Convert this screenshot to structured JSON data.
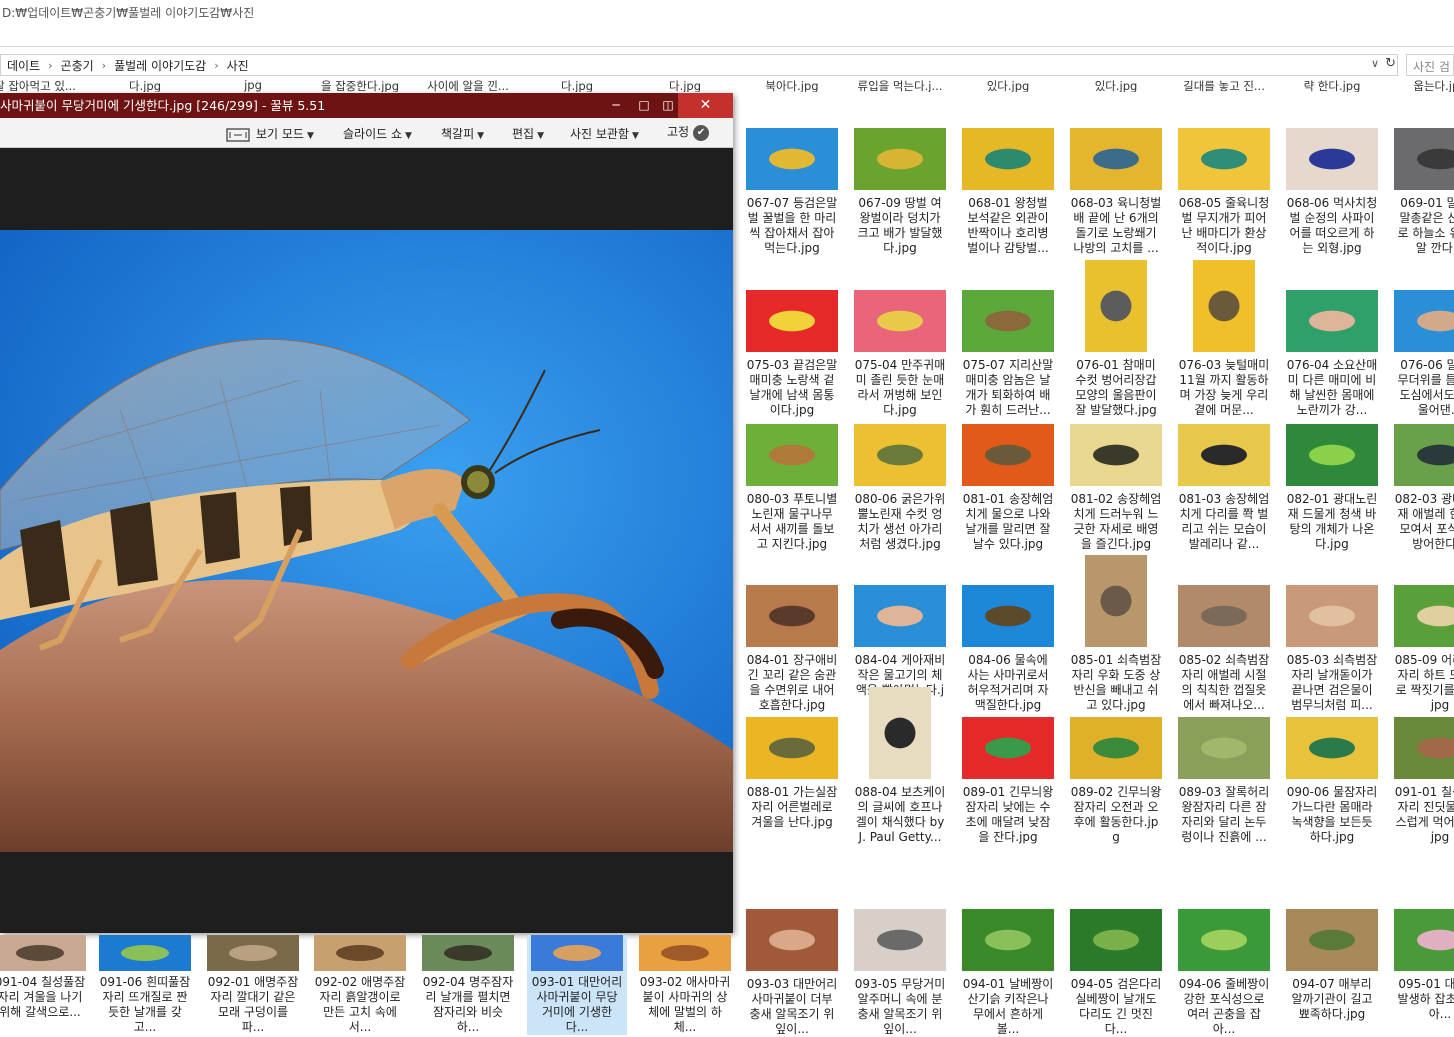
{
  "window": {
    "path_title": "D:₩업데이트₩곤충기₩풀벌레 이야기도감₩사진"
  },
  "address": {
    "crumbs": [
      "데이트",
      "곤충기",
      "풀벌레 이야기도감",
      "사진"
    ],
    "dropdown": "∨",
    "refresh": "↻",
    "search_placeholder": "사진 검"
  },
  "top_partial_captions": [
    "잘 잡아먹고 있...",
    "다.jpg",
    "jpg",
    "을 잡중한다.jpg",
    "사이에 알을 낀...",
    "다.jpg",
    "다.jpg",
    "북아다.jpg",
    "류입을 먹는다.j...",
    "있다.jpg",
    "있다.jpg",
    "길대를 놓고 진...",
    "략 한다.jpg",
    "웁는다.jpg"
  ],
  "grid": [
    {
      "caption": "067-07 등검은말벌 꿀벌을 한 마리씩 잡아채서 잡아먹는다.jpg",
      "colors": [
        "#2a8fd6",
        "#e2b832"
      ]
    },
    {
      "caption": "067-09 땅벌 여왕벌이라 덩치가 크고 배가 발달했다.jpg",
      "colors": [
        "#6aa42e",
        "#d8b433"
      ]
    },
    {
      "caption": "068-01 왕청벌 보석같은 외관이 반짝이나 호리병벌이나 감탕벌...",
      "colors": [
        "#e7b825",
        "#2e8a6c"
      ]
    },
    {
      "caption": "068-03 육니청벌 배 끝에 난 6개의 돌기로 노랑쐐기나방의 고치를 ...",
      "colors": [
        "#e5b52d",
        "#3d6b8a"
      ]
    },
    {
      "caption": "068-05 줄육니청벌 무지개가 피어난 배마디가 환상적이다.jpg",
      "colors": [
        "#f0c53a",
        "#2f8d78"
      ]
    },
    {
      "caption": "068-06 먹사치청벌 순정의 사파이어를 떠오르게 하는 외형.jpg",
      "colors": [
        "#e6d8cc",
        "#2a3a96"
      ]
    },
    {
      "caption": "069-01 말발을 말총같은 산란으로 하늘소 유충에 알 깐다...",
      "colors": [
        "#6b6a6c",
        "#3a3a3a"
      ]
    },
    {
      "caption": "075-03 끝검은말매미충 노랑색 겉날개에 남색 몸통이다.jpg",
      "colors": [
        "#e62a2a",
        "#f0d23a"
      ]
    },
    {
      "caption": "075-04 만주귀매미 졸린 듯한 눈매라서 꺼벙해 보인다.jpg",
      "colors": [
        "#e8657a",
        "#e9c94a"
      ]
    },
    {
      "caption": "075-07 지리산말매미충 암놈은 날개가 퇴화하여 배가 훤히 드러난...",
      "colors": [
        "#5da83a",
        "#8a6a3a"
      ]
    },
    {
      "caption": "076-01 참매미 수컷 벙어리장갑 모양의 울음판이 잘 발달했다.jpg",
      "colors": [
        "#e9c02e",
        "#5c5c5c"
      ]
    },
    {
      "caption": "076-03 늦털매미 11월 까지 활동하며 가장 늦게 우리곁에 머문...",
      "colors": [
        "#f0c02a",
        "#6a5a3a"
      ]
    },
    {
      "caption": "076-04 소요산매미 다른 매미에 비해 날씬한 몸매에 노란끼가 강...",
      "colors": [
        "#2fa06a",
        "#e0b49a"
      ]
    },
    {
      "caption": "076-06 말매미 무더위를 틈타 여 도심에서도 에도 울어댄...",
      "colors": [
        "#2a8fd6",
        "#d2a98a"
      ]
    },
    {
      "caption": "080-03 푸토니별노린재 물구나무서서 새끼를 돌보고 지킨다.jpg",
      "colors": [
        "#6cb03a",
        "#b07a3a"
      ]
    },
    {
      "caption": "080-06 굵은가위뿔노린재 수컷 엉치가 생선 아가리처럼 생겼다.jpg",
      "colors": [
        "#ecc030",
        "#6a7a3a"
      ]
    },
    {
      "caption": "081-01 송장헤엄치게 물으로 나와 날개를 말리면 잘 날수 있다.jpg",
      "colors": [
        "#e25a1a",
        "#6a5a3a"
      ]
    },
    {
      "caption": "081-02 송장헤엄치게 드러누워 느긋한 자세로 배영을 즐긴다.jpg",
      "colors": [
        "#e8d890",
        "#3a3a2a"
      ]
    },
    {
      "caption": "081-03 송장헤엄치게 다리를 쫙 벌리고 쉬는 모습이 발레리나 같...",
      "colors": [
        "#e8c84a",
        "#2a2a2a"
      ]
    },
    {
      "caption": "082-01 광대노린재 드물게 청색 바탕의 개체가 나온다.jpg",
      "colors": [
        "#2e8a3a",
        "#8ad04a"
      ]
    },
    {
      "caption": "082-03 광대노린재 애벌레 한데로 모여서 포식자를 방어한다...",
      "colors": [
        "#6aa04a",
        "#2a3a3a"
      ]
    },
    {
      "caption": "084-01 장구애비 긴 꼬리 같은 숨관을 수면위로 내어 호흡한다.jpg",
      "colors": [
        "#b87a4a",
        "#5a3a2a"
      ]
    },
    {
      "caption": "084-04 게아재비 작은 물고기의 체액을 빨아먹는다.jpg",
      "colors": [
        "#2a8fd6",
        "#e0b498"
      ]
    },
    {
      "caption": "084-06 물속에 사는 사마귀로서 허우적거리며 자맥질한다.jpg",
      "colors": [
        "#1e88d8",
        "#5a4a2a"
      ]
    },
    {
      "caption": "085-01 쇠측범잠자리 우화 도중 상반신을 빼내고 쉬고 있다.jpg",
      "colors": [
        "#b8986a",
        "#6a5a4a"
      ]
    },
    {
      "caption": "085-02 쇠측범잠자리 애벌레 시절의 칙칙한 껍질옷에서 빠져나오...",
      "colors": [
        "#b08a6a",
        "#7a6a5a"
      ]
    },
    {
      "caption": "085-03 쇠측범잠자리 날개돋이가 끝나면 검은물이 범무늬처럼 피...",
      "colors": [
        "#c89a7a",
        "#e0c0a0"
      ]
    },
    {
      "caption": "085-09 어리장잠자리 하트 모양으로 짝짓기를 한다.jpg",
      "colors": [
        "#5aa03a",
        "#e0d0a0"
      ]
    },
    {
      "caption": "088-01 가는실잠자리 어른벌레로 겨울을 난다.jpg",
      "colors": [
        "#eab624",
        "#6a6a3a"
      ]
    },
    {
      "caption": "088-04 보츠케이의 글씨에 호프나겔이 채식했다 by J. Paul Getty...",
      "colors": [
        "#e8dcc0",
        "#2a2a2a"
      ]
    },
    {
      "caption": "089-01 긴무늬왕잠자리 낮에는 수초에 매달려 낮잠을 잔다.jpg",
      "colors": [
        "#e42a2a",
        "#3a9a4a"
      ]
    },
    {
      "caption": "089-02 긴무늬왕잠자리 오전과 오후에 활동한다.jpg",
      "colors": [
        "#e0b02a",
        "#3a8a3a"
      ]
    },
    {
      "caption": "089-03 잘록허리왕잠자리 다른 잠자리와 달리 논두렁이나 진흙에 ...",
      "colors": [
        "#8aa05a",
        "#a0b86a"
      ]
    },
    {
      "caption": "090-06 물잠자리 가느다란 몸매라 녹색향을 보든듯 하다.jpg",
      "colors": [
        "#e8c23a",
        "#2a7a4a"
      ]
    },
    {
      "caption": "091-01 칠성풀잠자리 진딧물을 걸스럽게 먹어 운다.jpg",
      "colors": [
        "#6a8a3a",
        "#a06a4a"
      ]
    },
    {
      "caption": "093-03 대만어리사마귀붙이 더부충새 알목조기 위 잎이...",
      "colors": [
        "#a05a3a",
        "#d8a888"
      ]
    },
    {
      "caption": "093-05 무당거미 알주머니 속에 분충새 알목조기 위 잎이...",
      "colors": [
        "#d8d0c8",
        "#6a6a6a"
      ]
    },
    {
      "caption": "094-01 날베짱이 산기슭 키작은나무에서 흔하게 볼...",
      "colors": [
        "#3a8a2a",
        "#8ac05a"
      ]
    },
    {
      "caption": "094-05 검은다리실베짱이 날개도 다리도 긴 멋진다...",
      "colors": [
        "#2a7a2a",
        "#7ab04a"
      ]
    },
    {
      "caption": "094-06 줄베짱이 강한 포식성으로 여러 곤충을 잡아...",
      "colors": [
        "#3a9a3a",
        "#9ad05a"
      ]
    },
    {
      "caption": "094-07 매부리 알까기관이 길고 뾰족하다.jpg",
      "colors": [
        "#a88a5a",
        "#5a7a3a"
      ]
    },
    {
      "caption": "095-01 대 대량발생하 잡초를 잡아...",
      "colors": [
        "#4a9a3a",
        "#e0b0c0"
      ]
    }
  ],
  "viewer": {
    "title": "사마귀붙이 무당거미에 기생한다.jpg [246/299] - 꿀뷰 5.51",
    "min": "─",
    "max": "□",
    "pin": "◫",
    "close": "✕",
    "toolbar": {
      "view_mode": "보기 모드",
      "slideshow": "슬라이드 쇼",
      "bookmark": "책갈피",
      "edit": "편집",
      "photo_box": "사진 보관함",
      "fix": "고정",
      "fix_check": "✔"
    }
  },
  "bottom_strip": [
    {
      "caption": "091-04 칠성풀잠자리 겨울을 나기 위해 갈색으로...",
      "colors": [
        "#c8a890",
        "#5a4a3a"
      ]
    },
    {
      "caption": "091-06 흰띠풀잠자리 뜨개질로 짠 듯한 날개를 갖고...",
      "colors": [
        "#1e7ad0",
        "#8ac05a"
      ]
    },
    {
      "caption": "092-01 애명주잠자리 깔대기 같은 모래 구덩이를 파...",
      "colors": [
        "#7a6a4a",
        "#b8a080"
      ]
    },
    {
      "caption": "092-02 애명주잠자리 흙알갱이로 만든 고치 속에서...",
      "colors": [
        "#c8a070",
        "#6a4a2a"
      ]
    },
    {
      "caption": "092-04 명주잠자리 날개를 펼치면 잠자리와 비슷하...",
      "colors": [
        "#6a8a5a",
        "#3a3a2a"
      ]
    },
    {
      "caption": "093-01 대만어리사마귀붙이 무당거미에 기생한다...",
      "colors": [
        "#3a7ad8",
        "#d8a060"
      ]
    },
    {
      "caption": "093-02 애사마귀붙이 사마귀의 상체에 말벌의 하체...",
      "colors": [
        "#e8a040",
        "#a05a2a"
      ]
    }
  ],
  "chart_data": null
}
